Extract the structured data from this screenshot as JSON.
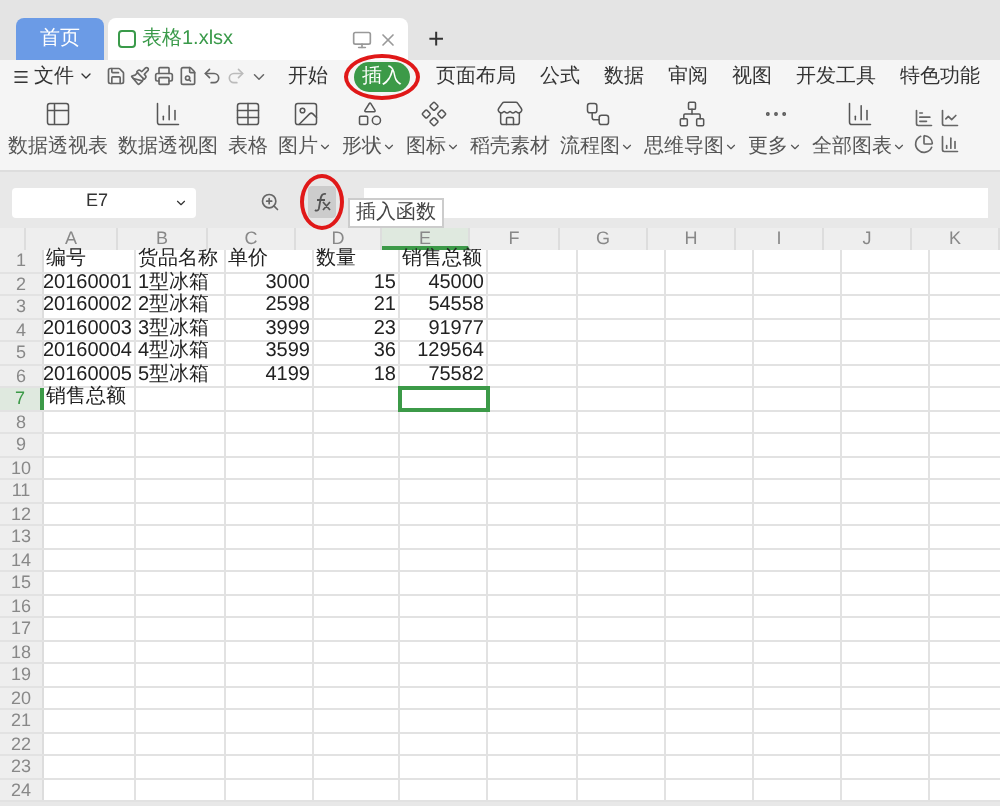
{
  "title_tabs": [
    {
      "label": "首页",
      "kind": "home",
      "selected": false
    },
    {
      "label": "表格1.xlsx",
      "kind": "document",
      "selected": true
    }
  ],
  "new_tab": "+",
  "file_menu": "文件",
  "menu_tabs": [
    {
      "label": "开始",
      "selected": false
    },
    {
      "label": "插入",
      "selected": true
    },
    {
      "label": "页面布局",
      "selected": false
    },
    {
      "label": "公式",
      "selected": false
    },
    {
      "label": "数据",
      "selected": false
    },
    {
      "label": "审阅",
      "selected": false
    },
    {
      "label": "视图",
      "selected": false
    },
    {
      "label": "开发工具",
      "selected": false
    },
    {
      "label": "特色功能",
      "selected": false
    }
  ],
  "ribbon": [
    {
      "label": "数据透视表",
      "kind": "pivot",
      "dropdown": false
    },
    {
      "label": "数据透视图",
      "kind": "pivot_chart",
      "dropdown": false
    },
    {
      "label": "表格",
      "kind": "table",
      "dropdown": false
    },
    {
      "label": "图片",
      "kind": "picture",
      "dropdown": true
    },
    {
      "label": "形状",
      "kind": "shape",
      "dropdown": true
    },
    {
      "label": "图标",
      "kind": "icons",
      "dropdown": true
    },
    {
      "label": "稻壳素材",
      "kind": "store",
      "dropdown": false
    },
    {
      "label": "流程图",
      "kind": "flow",
      "dropdown": true
    },
    {
      "label": "思维导图",
      "kind": "mind",
      "dropdown": true
    },
    {
      "label": "更多",
      "kind": "more",
      "dropdown": true
    },
    {
      "label": "全部图表",
      "kind": "chart",
      "dropdown": true
    }
  ],
  "formula_bar": {
    "name_box": "E7",
    "tooltip": "插入函数"
  },
  "sheet": {
    "columns": [
      {
        "label": "A",
        "numeric": true,
        "selected": false
      },
      {
        "label": "B",
        "numeric": false,
        "selected": false
      },
      {
        "label": "C",
        "numeric": true,
        "selected": false
      },
      {
        "label": "D",
        "numeric": true,
        "selected": false
      },
      {
        "label": "E",
        "numeric": true,
        "selected": true
      },
      {
        "label": "F",
        "selected": false
      },
      {
        "label": "G",
        "selected": false
      },
      {
        "label": "H",
        "selected": false
      },
      {
        "label": "I",
        "selected": false
      },
      {
        "label": "J",
        "selected": false
      },
      {
        "label": "K",
        "selected": false
      }
    ],
    "rows": [
      {
        "label": "1",
        "kind": "header",
        "selected": false,
        "cells": [
          "编号",
          "货品名称",
          "单价",
          "数量",
          "销售总额"
        ]
      },
      {
        "label": "2",
        "kind": "data",
        "selected": false,
        "cells": [
          "20160001",
          "1型冰箱",
          "3000",
          "15",
          "45000"
        ]
      },
      {
        "label": "3",
        "kind": "data",
        "selected": false,
        "cells": [
          "20160002",
          "2型冰箱",
          "2598",
          "21",
          "54558"
        ]
      },
      {
        "label": "4",
        "kind": "data",
        "selected": false,
        "cells": [
          "20160003",
          "3型冰箱",
          "3999",
          "23",
          "91977"
        ]
      },
      {
        "label": "5",
        "kind": "data",
        "selected": false,
        "cells": [
          "20160004",
          "4型冰箱",
          "3599",
          "36",
          "129564"
        ]
      },
      {
        "label": "6",
        "kind": "data",
        "selected": false,
        "cells": [
          "20160005",
          "5型冰箱",
          "4199",
          "18",
          "75582"
        ]
      },
      {
        "label": "7",
        "kind": "header",
        "selected": true,
        "cells": [
          "销售总额"
        ]
      },
      {
        "label": "8",
        "kind": "data",
        "selected": false
      },
      {
        "label": "9",
        "kind": "data",
        "selected": false
      },
      {
        "label": "10",
        "kind": "data",
        "selected": false
      },
      {
        "label": "11",
        "kind": "data",
        "selected": false
      },
      {
        "label": "12",
        "kind": "data",
        "selected": false
      },
      {
        "label": "13",
        "kind": "data",
        "selected": false
      },
      {
        "label": "14",
        "kind": "data",
        "selected": false
      },
      {
        "label": "15",
        "kind": "data",
        "selected": false
      },
      {
        "label": "16",
        "kind": "data",
        "selected": false
      },
      {
        "label": "17",
        "kind": "data",
        "selected": false
      },
      {
        "label": "18",
        "kind": "data",
        "selected": false
      },
      {
        "label": "19",
        "kind": "data",
        "selected": false
      },
      {
        "label": "20",
        "kind": "data",
        "selected": false
      },
      {
        "label": "21",
        "kind": "data",
        "selected": false
      },
      {
        "label": "22",
        "kind": "data",
        "selected": false
      },
      {
        "label": "23",
        "kind": "data",
        "selected": false
      },
      {
        "label": "24",
        "kind": "data",
        "selected": false
      }
    ]
  }
}
